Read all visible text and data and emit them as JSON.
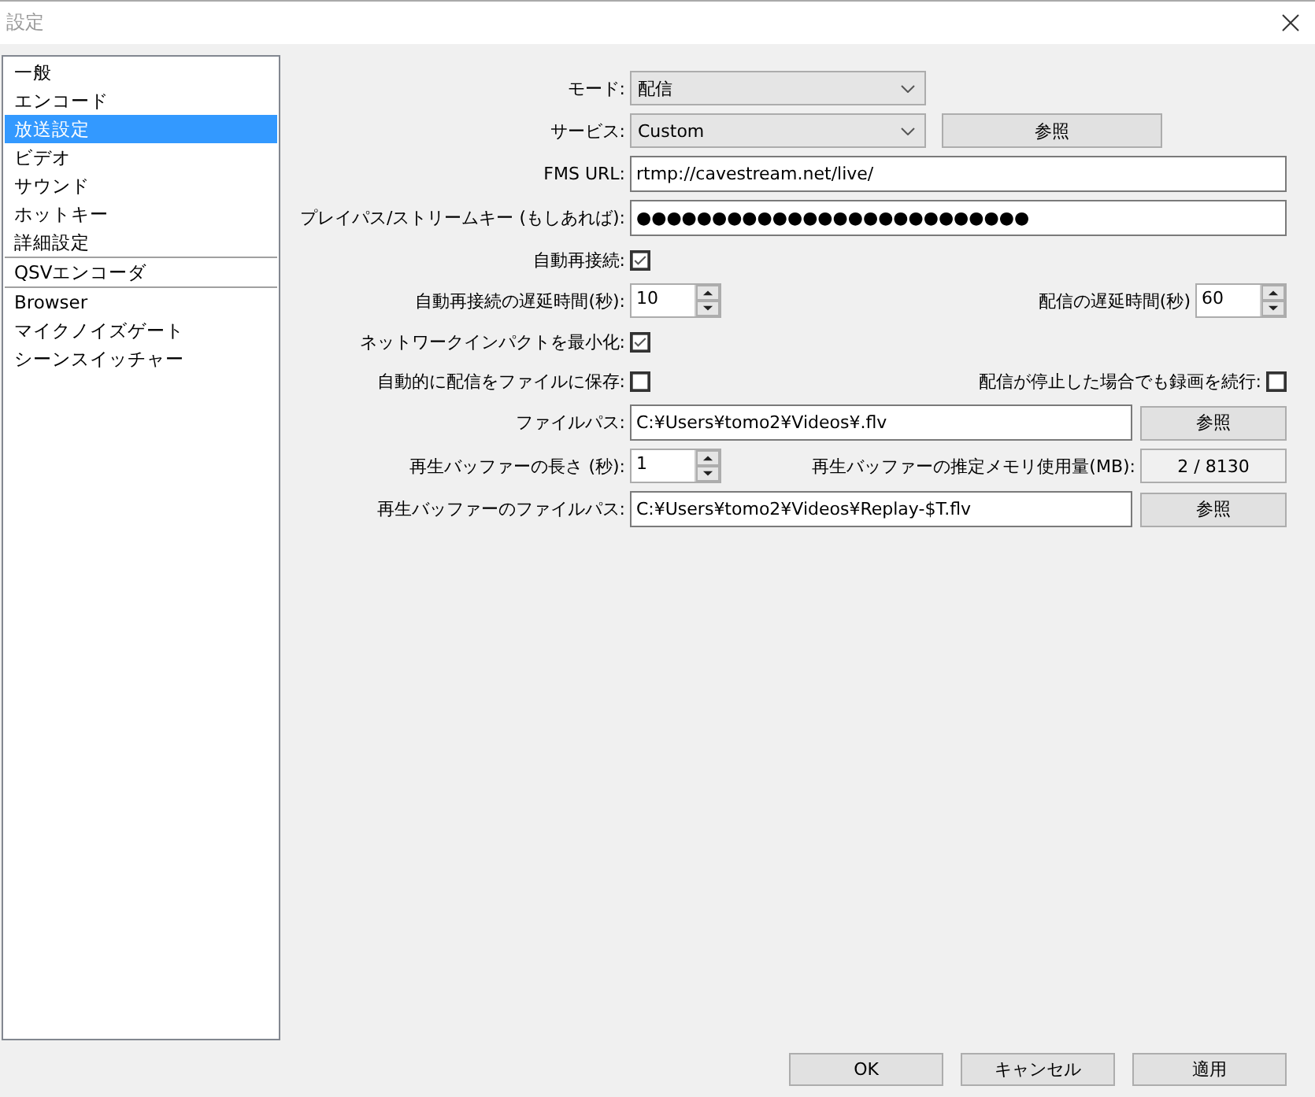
{
  "window": {
    "title": "設定"
  },
  "sidebar": {
    "groups": [
      [
        {
          "label": "一般",
          "selected": false
        },
        {
          "label": "エンコード",
          "selected": false
        },
        {
          "label": "放送設定",
          "selected": true
        },
        {
          "label": "ビデオ",
          "selected": false
        },
        {
          "label": "サウンド",
          "selected": false
        },
        {
          "label": "ホットキー",
          "selected": false
        },
        {
          "label": "詳細設定",
          "selected": false
        }
      ],
      [
        {
          "label": "QSVエンコーダ",
          "selected": false
        }
      ],
      [
        {
          "label": "Browser",
          "selected": false
        },
        {
          "label": "マイクノイズゲート",
          "selected": false
        },
        {
          "label": "シーンスイッチャー",
          "selected": false
        }
      ]
    ]
  },
  "form": {
    "rows": [
      {
        "label": "モード:",
        "controls": [
          {
            "kind": "select",
            "value": "配信"
          }
        ]
      },
      {
        "label": "サービス:",
        "controls": [
          {
            "kind": "select",
            "value": "Custom"
          },
          {
            "kind": "button",
            "text": "参照"
          }
        ]
      },
      {
        "label": "FMS URL:",
        "controls": [
          {
            "kind": "text",
            "value": "rtmp://cavestream.net/live/"
          }
        ]
      },
      {
        "label": "プレイパス/ストリームキー (もしあれば):",
        "controls": [
          {
            "kind": "text",
            "value": "●●●●●●●●●●●●●●●●●●●●●●●●●●"
          }
        ]
      },
      {
        "label": "自動再接続:",
        "controls": [
          {
            "kind": "checkbox",
            "checked": true
          }
        ]
      },
      {
        "label": "自動再接続の遅延時間(秒):",
        "controls": [
          {
            "kind": "spin",
            "value": "10"
          },
          {
            "kind": "label",
            "text": "配信の遅延時間(秒)"
          },
          {
            "kind": "spin",
            "value": "60"
          }
        ]
      },
      {
        "label": "ネットワークインパクトを最小化:",
        "controls": [
          {
            "kind": "checkbox",
            "checked": true
          }
        ]
      },
      {
        "label": "自動的に配信をファイルに保存:",
        "controls": [
          {
            "kind": "checkbox",
            "checked": false
          },
          {
            "kind": "label",
            "text": "配信が停止した場合でも録画を続行:"
          },
          {
            "kind": "checkbox",
            "checked": false
          }
        ]
      },
      {
        "label": "ファイルパス:",
        "controls": [
          {
            "kind": "text",
            "value": "C:¥Users¥tomo2¥Videos¥.flv"
          },
          {
            "kind": "button",
            "text": "参照"
          }
        ]
      },
      {
        "label": "再生バッファーの長さ (秒):",
        "controls": [
          {
            "kind": "spin",
            "value": "1"
          },
          {
            "kind": "label",
            "text": "再生バッファーの推定メモリ使用量(MB):"
          },
          {
            "kind": "readout",
            "text": "2 / 8130"
          }
        ]
      },
      {
        "label": "再生バッファーのファイルパス:",
        "controls": [
          {
            "kind": "text",
            "value": "C:¥Users¥tomo2¥Videos¥Replay-$T.flv"
          },
          {
            "kind": "button",
            "text": "参照"
          }
        ]
      }
    ]
  },
  "buttons": [
    "OK",
    "キャンセル",
    "適用"
  ]
}
